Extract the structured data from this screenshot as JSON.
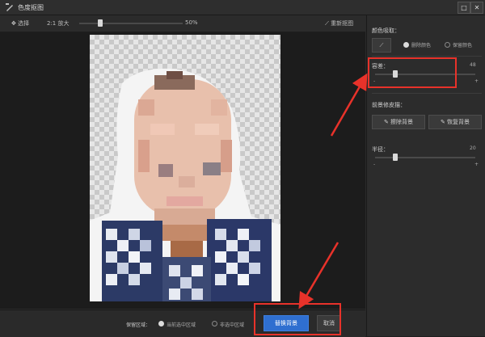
{
  "window": {
    "title": "色度抠图",
    "minimize": "□",
    "close": "✕"
  },
  "toolbar": {
    "select_label": "选择",
    "zoom_label": "2:1 放大",
    "zoom_value": "50%",
    "zoom_level": 0.2,
    "reset_label": "重新抠图"
  },
  "panel": {
    "color_pick": {
      "label": "颜色吸取：",
      "option_delete": "删除颜色",
      "option_keep": "保留颜色",
      "selected": "删除颜色"
    },
    "tolerance": {
      "label": "容差：",
      "value": "48",
      "level": 0.2,
      "min_mark": "-",
      "max_mark": "+"
    },
    "brush": {
      "label": "前景修皮描：",
      "erase_bg": "擦除背景",
      "restore_bg": "恢复背景"
    },
    "radius": {
      "label": "半径：",
      "value": "20",
      "level": 0.2,
      "min_mark": "-",
      "max_mark": "+"
    }
  },
  "bottom": {
    "keep_area_label": "保留区域：",
    "option_selected": "当前选中区域",
    "option_unselected": "非选中区域",
    "confirm": "替换背景",
    "cancel": "取消"
  },
  "colors": {
    "accent": "#2f6fd0",
    "highlight": "#e8322a"
  }
}
